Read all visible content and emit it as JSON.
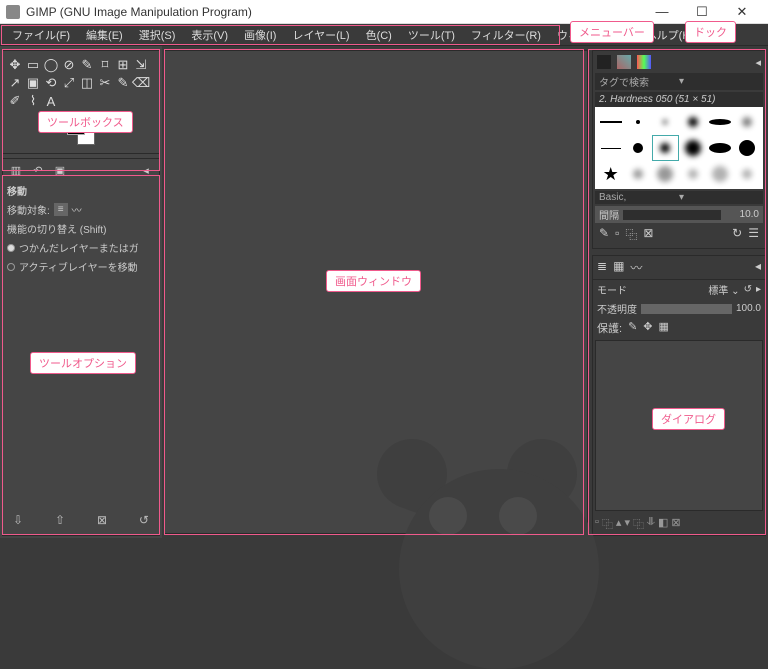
{
  "title": "GIMP (GNU Image Manipulation Program)",
  "window_buttons": {
    "min": "—",
    "max": "☐",
    "close": "✕"
  },
  "menu": [
    "ファイル(F)",
    "編集(E)",
    "選択(S)",
    "表示(V)",
    "画像(I)",
    "レイヤー(L)",
    "色(C)",
    "ツール(T)",
    "フィルター(R)",
    "ウィンドウ(W)",
    "ヘルプ(H)"
  ],
  "toolbox_icons": [
    "✥",
    "▭",
    "◯",
    "⊘",
    "✎",
    "⌑",
    "⊞",
    "⇲",
    "↗",
    "▣",
    "⟲",
    "⤢",
    "◫",
    "✂",
    "✎",
    "⌫",
    "✐",
    "⌇",
    "A"
  ],
  "tool_options": {
    "title": "移動",
    "target_label": "移動対象:",
    "shift_label": "機能の切り替え (Shift)",
    "opt1": "つかんだレイヤーまたはガ",
    "opt2": "アクティブレイヤーを移動"
  },
  "brush_panel": {
    "search": "タグで検索",
    "label": "2. Hardness 050 (51 × 51)",
    "preset": "Basic,",
    "spacing_label": "間隔",
    "spacing_value": "10.0"
  },
  "layers_panel": {
    "mode_label": "モード",
    "mode_value": "標準",
    "opacity_label": "不透明度",
    "opacity_value": "100.0",
    "lock_label": "保護:"
  },
  "annotations": {
    "menubar": "メニューバー",
    "dock": "ドック",
    "toolbox": "ツールボックス",
    "canvas": "画面ウィンドウ",
    "tool_options": "ツールオプション",
    "dialog": "ダイアログ"
  }
}
